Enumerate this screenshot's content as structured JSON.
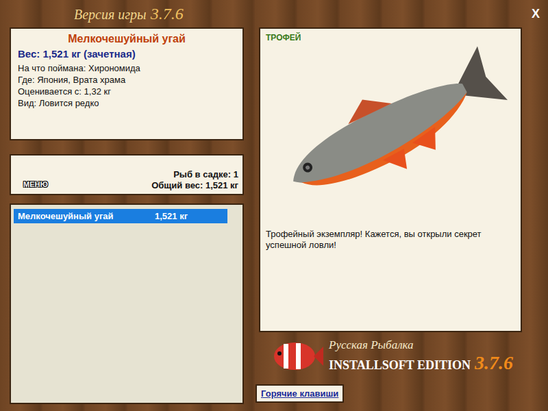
{
  "window": {
    "title": "Версия игры",
    "version": "3.7.6",
    "close": "X"
  },
  "details": {
    "name": "Мелкочешуйный угай",
    "weight": "Вес: 1,521 кг (зачетная)",
    "lines": [
      "На что поймана: Хирономида",
      "Где: Япония, Врата храма",
      "Оценивается с: 1,32 кг",
      "Вид: Ловится редко"
    ]
  },
  "keepnet": {
    "menu": "МЕНЮ",
    "count": "Рыб в садке: 1",
    "total": "Общий вес: 1,521 кг"
  },
  "catch_list": [
    {
      "name": "Мелкочешуйный угай",
      "weight": "1,521 кг",
      "selected": true
    }
  ],
  "trophy": {
    "badge": "ТРОФЕЙ",
    "message": "Трофейный экземпляр! Кажется, вы открыли секрет успешной ловли!"
  },
  "brand": {
    "name": "Русская Рыбалка",
    "edition": "INSTALLSOFT EDITION",
    "version": "3.7.6"
  },
  "hotkeys_button": "Горячие клавиши"
}
